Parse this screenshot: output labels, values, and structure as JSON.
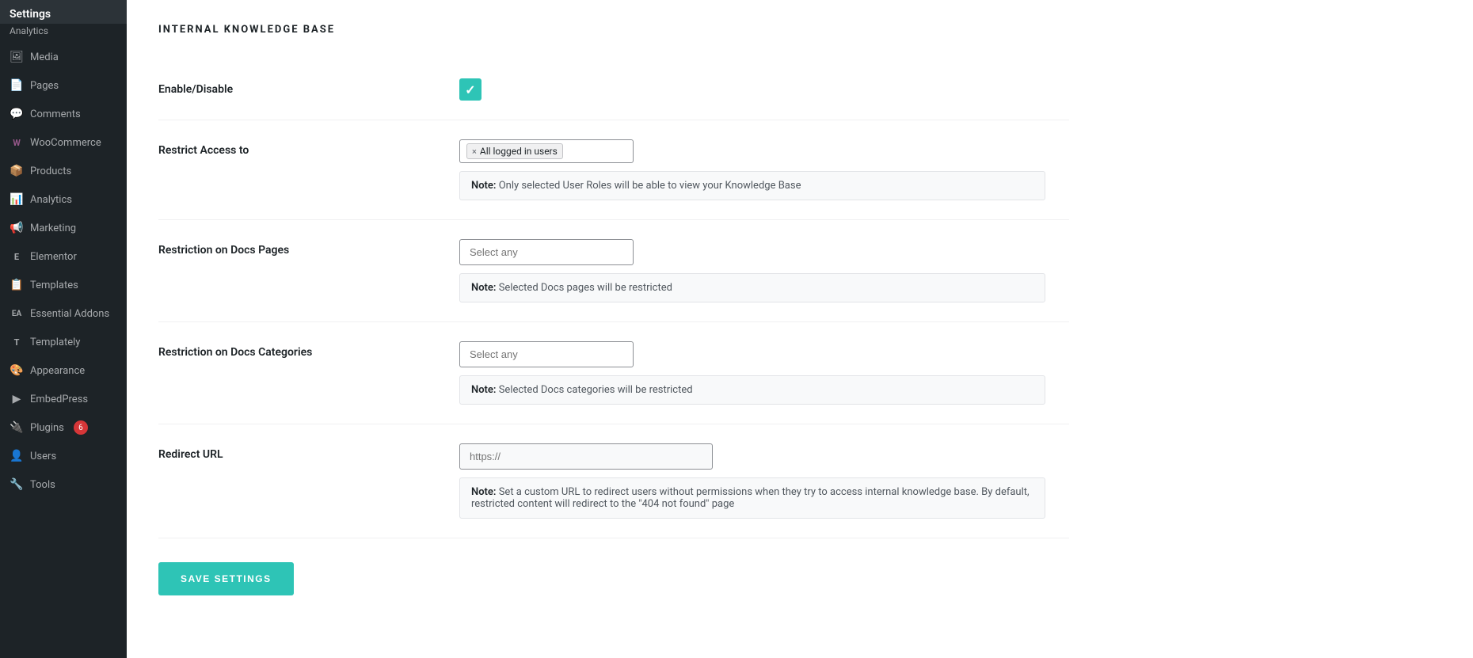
{
  "sidebar": {
    "items": [
      {
        "id": "settings",
        "label": "Settings",
        "icon": "⚙",
        "isHeader": true
      },
      {
        "id": "analytics-sub",
        "label": "Analytics",
        "icon": "",
        "isSubLabel": true
      },
      {
        "id": "media",
        "label": "Media",
        "icon": "🖼"
      },
      {
        "id": "pages",
        "label": "Pages",
        "icon": "📄"
      },
      {
        "id": "comments",
        "label": "Comments",
        "icon": "💬"
      },
      {
        "id": "woocommerce",
        "label": "WooCommerce",
        "icon": "W"
      },
      {
        "id": "products",
        "label": "Products",
        "icon": "📦"
      },
      {
        "id": "analytics",
        "label": "Analytics",
        "icon": "📊"
      },
      {
        "id": "marketing",
        "label": "Marketing",
        "icon": "📢"
      },
      {
        "id": "elementor",
        "label": "Elementor",
        "icon": "E"
      },
      {
        "id": "templates",
        "label": "Templates",
        "icon": "📋"
      },
      {
        "id": "essential-addons",
        "label": "Essential Addons",
        "icon": "EA"
      },
      {
        "id": "templately",
        "label": "Templately",
        "icon": "T"
      },
      {
        "id": "appearance",
        "label": "Appearance",
        "icon": "🎨"
      },
      {
        "id": "embedpress",
        "label": "EmbedPress",
        "icon": "▶"
      },
      {
        "id": "plugins",
        "label": "Plugins",
        "icon": "🔌",
        "badge": "6"
      },
      {
        "id": "users",
        "label": "Users",
        "icon": "👤"
      },
      {
        "id": "tools",
        "label": "Tools",
        "icon": "🔧"
      }
    ]
  },
  "page": {
    "title": "INTERNAL KNOWLEDGE BASE",
    "rows": [
      {
        "id": "enable-disable",
        "label": "Enable/Disable",
        "type": "checkbox",
        "checked": true
      },
      {
        "id": "restrict-access",
        "label": "Restrict Access to",
        "type": "tag-input",
        "tags": [
          "All logged in users"
        ],
        "note": "Only selected User Roles will be able to view your Knowledge Base",
        "note_label": "Note:"
      },
      {
        "id": "restriction-docs-pages",
        "label": "Restriction on Docs Pages",
        "type": "select",
        "placeholder": "Select any",
        "note": "Selected Docs pages will be restricted",
        "note_label": "Note:"
      },
      {
        "id": "restriction-docs-categories",
        "label": "Restriction on Docs Categories",
        "type": "select",
        "placeholder": "Select any",
        "note": "Selected Docs categories will be restricted",
        "note_label": "Note:"
      },
      {
        "id": "redirect-url",
        "label": "Redirect URL",
        "type": "url-input",
        "placeholder": "https://",
        "note": "Set a custom URL to redirect users without permissions when they try to access internal knowledge base. By default, restricted content will redirect to the \"404 not found\" page",
        "note_label": "Note:"
      }
    ],
    "save_button_label": "SAVE SETTINGS"
  }
}
